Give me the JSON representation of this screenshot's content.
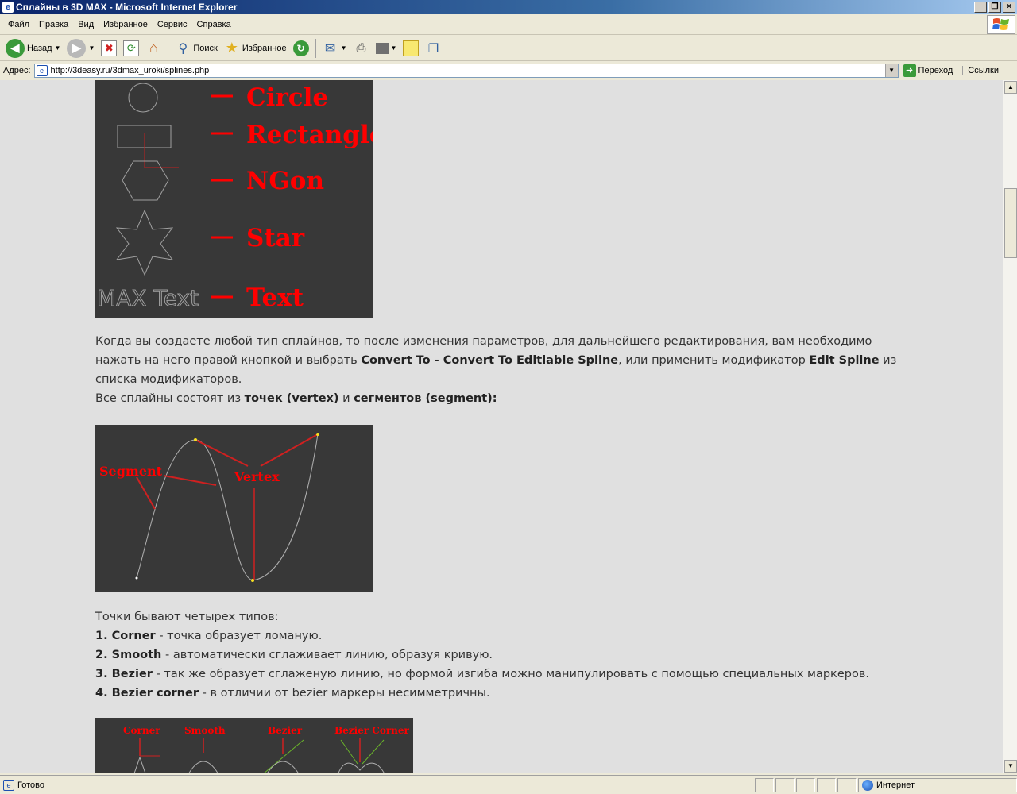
{
  "window": {
    "title": "Сплайны в 3D MAX - Microsoft Internet Explorer",
    "app_icon": "e"
  },
  "menu": [
    {
      "label": "Файл"
    },
    {
      "label": "Правка"
    },
    {
      "label": "Вид"
    },
    {
      "label": "Избранное"
    },
    {
      "label": "Сервис"
    },
    {
      "label": "Справка"
    }
  ],
  "toolbar": {
    "back_label": "Назад",
    "search_label": "Поиск",
    "favorites_label": "Избранное"
  },
  "address": {
    "label": "Адрес:",
    "url": "http://3deasy.ru/3dmax_uroki/splines.php",
    "go_label": "Переход",
    "links_label": "Ссылки"
  },
  "figure1": {
    "items": [
      "Circle",
      "Rectangle",
      "NGon",
      "Star",
      "Text"
    ],
    "max_text": "MAX Text"
  },
  "figure2": {
    "segment_label": "Segment",
    "vertex_label": "Vertex"
  },
  "figure3": {
    "labels": [
      "Corner",
      "Smooth",
      "Bezier",
      "Bezier Corner"
    ]
  },
  "content": {
    "p1_a": "Когда вы создаете любой тип сплайнов, то после изменения параметров, для дальнейшего редактирования, вам необходимо нажать на него правой кнопкой и выбрать ",
    "p1_b": "Convert To - Convert To Editiable Spline",
    "p1_c": ", или применить модификатор ",
    "p1_d": "Edit Spline",
    "p1_e": " из списка модификаторов.",
    "p2_a": "Все сплайны состоят из ",
    "p2_b": "точек (vertex)",
    "p2_c": " и ",
    "p2_d": "сегментов (segment):",
    "types_intro": "Точки бывают четырех типов:",
    "types": [
      {
        "name": "1. Corner",
        "desc": " - точка образует ломаную."
      },
      {
        "name": "2. Smooth",
        "desc": " - автоматически сглаживает линию, образуя кривую."
      },
      {
        "name": "3. Bezier",
        "desc": " - так же образует сглаженую линию, но формой изгиба можно манипулировать с помощью специальных маркеров."
      },
      {
        "name": "4. Bezier corner",
        "desc": " - в отличии от bezier маркеры несимметричны."
      }
    ]
  },
  "status": {
    "text": "Готово",
    "zone": "Интернет"
  },
  "colors": {
    "accent_red": "#ff0000",
    "figure_bg": "#383838",
    "page_bg": "#e0e0e0"
  }
}
